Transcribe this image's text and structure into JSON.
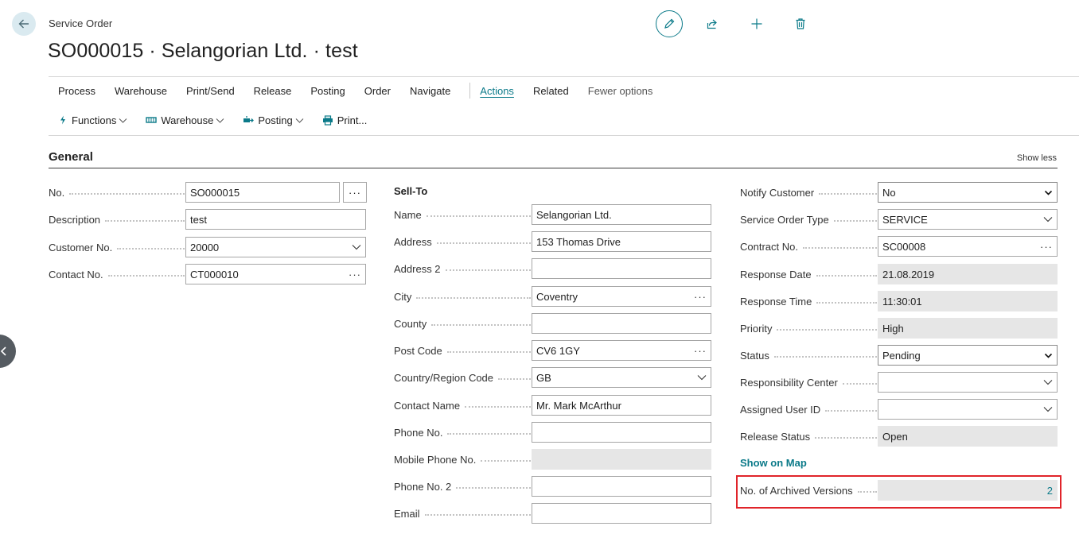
{
  "header": {
    "subtitle": "Service Order",
    "title": "SO000015 · Selangorian Ltd. · test"
  },
  "menu": {
    "items": [
      "Process",
      "Warehouse",
      "Print/Send",
      "Release",
      "Posting",
      "Order",
      "Navigate"
    ],
    "actions": "Actions",
    "related": "Related",
    "fewer": "Fewer options"
  },
  "submenu": {
    "functions": "Functions",
    "warehouse": "Warehouse",
    "posting": "Posting",
    "print": "Print..."
  },
  "section": {
    "title": "General",
    "toggle": "Show less"
  },
  "general": {
    "no_label": "No.",
    "no_value": "SO000015",
    "description_label": "Description",
    "description_value": "test",
    "customer_no_label": "Customer No.",
    "customer_no_value": "20000",
    "contact_no_label": "Contact No.",
    "contact_no_value": "CT000010"
  },
  "sell_to": {
    "group": "Sell-To",
    "name_label": "Name",
    "name_value": "Selangorian Ltd.",
    "address_label": "Address",
    "address_value": "153 Thomas Drive",
    "address2_label": "Address 2",
    "address2_value": "",
    "city_label": "City",
    "city_value": "Coventry",
    "county_label": "County",
    "county_value": "",
    "post_code_label": "Post Code",
    "post_code_value": "CV6 1GY",
    "country_label": "Country/Region Code",
    "country_value": "GB",
    "contact_name_label": "Contact Name",
    "contact_name_value": "Mr. Mark McArthur",
    "phone_label": "Phone No.",
    "phone_value": "",
    "mobile_label": "Mobile Phone No.",
    "mobile_value": "",
    "phone2_label": "Phone No. 2",
    "phone2_value": "",
    "email_label": "Email",
    "email_value": ""
  },
  "details": {
    "notify_label": "Notify Customer",
    "notify_value": "No",
    "type_label": "Service Order Type",
    "type_value": "SERVICE",
    "contract_label": "Contract No.",
    "contract_value": "SC00008",
    "resp_date_label": "Response Date",
    "resp_date_value": "21.08.2019",
    "resp_time_label": "Response Time",
    "resp_time_value": "11:30:01",
    "priority_label": "Priority",
    "priority_value": "High",
    "status_label": "Status",
    "status_value": "Pending",
    "resp_center_label": "Responsibility Center",
    "resp_center_value": "",
    "assigned_label": "Assigned User ID",
    "assigned_value": "",
    "release_label": "Release Status",
    "release_value": "Open",
    "map_link": "Show on Map",
    "archived_label": "No. of Archived Versions",
    "archived_value": "2"
  },
  "colors": {
    "accent": "#0b7a89",
    "highlight": "#e0242a",
    "readonly_bg": "#e6e6e6"
  }
}
